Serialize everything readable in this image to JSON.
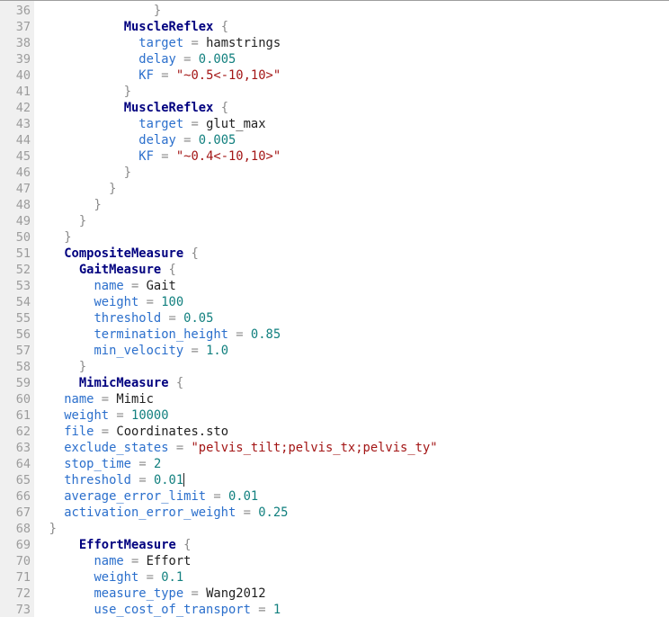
{
  "editor": {
    "name": "code-editor",
    "language": "scone-config",
    "first_visible_line": 36,
    "last_visible_line": 73,
    "cursor": {
      "line": 65,
      "column": 21,
      "after_text": "threshold = 0.01"
    },
    "colors": {
      "background": "#ffffff",
      "gutter_background": "#f0f0f0",
      "gutter_text": "#9c9c9c",
      "type_name": "#00007f",
      "property": "#2b6fcc",
      "number": "#12807f",
      "string": "#a31515",
      "punctuation": "#8a8a8a",
      "plain_text": "#1f1f1f",
      "caret": "#202020",
      "top_border": "#9e9e9e"
    }
  },
  "lines": [
    {
      "num": "36",
      "indent": 14,
      "tokens": [
        {
          "t": "}",
          "c": "punc"
        }
      ]
    },
    {
      "num": "37",
      "indent": 10,
      "tokens": [
        {
          "t": "MuscleReflex",
          "c": "type"
        },
        {
          "t": " ",
          "c": "plain"
        },
        {
          "t": "{",
          "c": "punc"
        }
      ]
    },
    {
      "num": "38",
      "indent": 12,
      "tokens": [
        {
          "t": "target",
          "c": "prop"
        },
        {
          "t": " ",
          "c": "plain"
        },
        {
          "t": "=",
          "c": "punc"
        },
        {
          "t": " ",
          "c": "plain"
        },
        {
          "t": "hamstrings",
          "c": "plain"
        }
      ]
    },
    {
      "num": "39",
      "indent": 12,
      "tokens": [
        {
          "t": "delay",
          "c": "prop"
        },
        {
          "t": " ",
          "c": "plain"
        },
        {
          "t": "=",
          "c": "punc"
        },
        {
          "t": " ",
          "c": "plain"
        },
        {
          "t": "0.005",
          "c": "num"
        }
      ]
    },
    {
      "num": "40",
      "indent": 12,
      "tokens": [
        {
          "t": "KF",
          "c": "prop"
        },
        {
          "t": " ",
          "c": "plain"
        },
        {
          "t": "=",
          "c": "punc"
        },
        {
          "t": " ",
          "c": "plain"
        },
        {
          "t": "\"~0.5<-10,10>\"",
          "c": "str"
        }
      ]
    },
    {
      "num": "41",
      "indent": 10,
      "tokens": [
        {
          "t": "}",
          "c": "punc"
        }
      ]
    },
    {
      "num": "42",
      "indent": 10,
      "tokens": [
        {
          "t": "MuscleReflex",
          "c": "type"
        },
        {
          "t": " ",
          "c": "plain"
        },
        {
          "t": "{",
          "c": "punc"
        }
      ]
    },
    {
      "num": "43",
      "indent": 12,
      "tokens": [
        {
          "t": "target",
          "c": "prop"
        },
        {
          "t": " ",
          "c": "plain"
        },
        {
          "t": "=",
          "c": "punc"
        },
        {
          "t": " ",
          "c": "plain"
        },
        {
          "t": "glut_max",
          "c": "plain"
        }
      ]
    },
    {
      "num": "44",
      "indent": 12,
      "tokens": [
        {
          "t": "delay",
          "c": "prop"
        },
        {
          "t": " ",
          "c": "plain"
        },
        {
          "t": "=",
          "c": "punc"
        },
        {
          "t": " ",
          "c": "plain"
        },
        {
          "t": "0.005",
          "c": "num"
        }
      ]
    },
    {
      "num": "45",
      "indent": 12,
      "tokens": [
        {
          "t": "KF",
          "c": "prop"
        },
        {
          "t": " ",
          "c": "plain"
        },
        {
          "t": "=",
          "c": "punc"
        },
        {
          "t": " ",
          "c": "plain"
        },
        {
          "t": "\"~0.4<-10,10>\"",
          "c": "str"
        }
      ]
    },
    {
      "num": "46",
      "indent": 10,
      "tokens": [
        {
          "t": "}",
          "c": "punc"
        }
      ]
    },
    {
      "num": "47",
      "indent": 8,
      "tokens": [
        {
          "t": "}",
          "c": "punc"
        }
      ]
    },
    {
      "num": "48",
      "indent": 6,
      "tokens": [
        {
          "t": "}",
          "c": "punc"
        }
      ]
    },
    {
      "num": "49",
      "indent": 4,
      "tokens": [
        {
          "t": "}",
          "c": "punc"
        }
      ]
    },
    {
      "num": "50",
      "indent": 2,
      "tokens": [
        {
          "t": "}",
          "c": "punc"
        }
      ]
    },
    {
      "num": "51",
      "indent": 2,
      "tokens": [
        {
          "t": "CompositeMeasure",
          "c": "type"
        },
        {
          "t": " ",
          "c": "plain"
        },
        {
          "t": "{",
          "c": "punc"
        }
      ]
    },
    {
      "num": "52",
      "indent": 4,
      "tokens": [
        {
          "t": "GaitMeasure",
          "c": "type"
        },
        {
          "t": " ",
          "c": "plain"
        },
        {
          "t": "{",
          "c": "punc"
        }
      ]
    },
    {
      "num": "53",
      "indent": 6,
      "tokens": [
        {
          "t": "name",
          "c": "prop"
        },
        {
          "t": " ",
          "c": "plain"
        },
        {
          "t": "=",
          "c": "punc"
        },
        {
          "t": " ",
          "c": "plain"
        },
        {
          "t": "Gait",
          "c": "plain"
        }
      ]
    },
    {
      "num": "54",
      "indent": 6,
      "tokens": [
        {
          "t": "weight",
          "c": "prop"
        },
        {
          "t": " ",
          "c": "plain"
        },
        {
          "t": "=",
          "c": "punc"
        },
        {
          "t": " ",
          "c": "plain"
        },
        {
          "t": "100",
          "c": "num"
        }
      ]
    },
    {
      "num": "55",
      "indent": 6,
      "tokens": [
        {
          "t": "threshold",
          "c": "prop"
        },
        {
          "t": " ",
          "c": "plain"
        },
        {
          "t": "=",
          "c": "punc"
        },
        {
          "t": " ",
          "c": "plain"
        },
        {
          "t": "0.05",
          "c": "num"
        }
      ]
    },
    {
      "num": "56",
      "indent": 6,
      "tokens": [
        {
          "t": "termination_height",
          "c": "prop"
        },
        {
          "t": " ",
          "c": "plain"
        },
        {
          "t": "=",
          "c": "punc"
        },
        {
          "t": " ",
          "c": "plain"
        },
        {
          "t": "0.85",
          "c": "num"
        }
      ]
    },
    {
      "num": "57",
      "indent": 6,
      "tokens": [
        {
          "t": "min_velocity",
          "c": "prop"
        },
        {
          "t": " ",
          "c": "plain"
        },
        {
          "t": "=",
          "c": "punc"
        },
        {
          "t": " ",
          "c": "plain"
        },
        {
          "t": "1.0",
          "c": "num"
        }
      ]
    },
    {
      "num": "58",
      "indent": 4,
      "tokens": [
        {
          "t": "}",
          "c": "punc"
        }
      ]
    },
    {
      "num": "59",
      "indent": 4,
      "tokens": [
        {
          "t": "MimicMeasure",
          "c": "type"
        },
        {
          "t": " ",
          "c": "plain"
        },
        {
          "t": "{",
          "c": "punc"
        }
      ]
    },
    {
      "num": "60",
      "indent": 2,
      "tokens": [
        {
          "t": "name",
          "c": "prop"
        },
        {
          "t": " ",
          "c": "plain"
        },
        {
          "t": "=",
          "c": "punc"
        },
        {
          "t": " ",
          "c": "plain"
        },
        {
          "t": "Mimic",
          "c": "plain"
        }
      ]
    },
    {
      "num": "61",
      "indent": 2,
      "tokens": [
        {
          "t": "weight",
          "c": "prop"
        },
        {
          "t": " ",
          "c": "plain"
        },
        {
          "t": "=",
          "c": "punc"
        },
        {
          "t": " ",
          "c": "plain"
        },
        {
          "t": "10000",
          "c": "num"
        }
      ]
    },
    {
      "num": "62",
      "indent": 2,
      "tokens": [
        {
          "t": "file",
          "c": "prop"
        },
        {
          "t": " ",
          "c": "plain"
        },
        {
          "t": "=",
          "c": "punc"
        },
        {
          "t": " ",
          "c": "plain"
        },
        {
          "t": "Coordinates.sto",
          "c": "plain"
        }
      ]
    },
    {
      "num": "63",
      "indent": 2,
      "tokens": [
        {
          "t": "exclude_states",
          "c": "prop"
        },
        {
          "t": " ",
          "c": "plain"
        },
        {
          "t": "=",
          "c": "punc"
        },
        {
          "t": " ",
          "c": "plain"
        },
        {
          "t": "\"pelvis_tilt;pelvis_tx;pelvis_ty\"",
          "c": "str"
        }
      ]
    },
    {
      "num": "64",
      "indent": 2,
      "tokens": [
        {
          "t": "stop_time",
          "c": "prop"
        },
        {
          "t": " ",
          "c": "plain"
        },
        {
          "t": "=",
          "c": "punc"
        },
        {
          "t": " ",
          "c": "plain"
        },
        {
          "t": "2",
          "c": "num"
        }
      ]
    },
    {
      "num": "65",
      "indent": 2,
      "caret_at_end": true,
      "tokens": [
        {
          "t": "threshold",
          "c": "prop"
        },
        {
          "t": " ",
          "c": "plain"
        },
        {
          "t": "=",
          "c": "punc"
        },
        {
          "t": " ",
          "c": "plain"
        },
        {
          "t": "0.01",
          "c": "num"
        }
      ]
    },
    {
      "num": "66",
      "indent": 2,
      "tokens": [
        {
          "t": "average_error_limit",
          "c": "prop"
        },
        {
          "t": " ",
          "c": "plain"
        },
        {
          "t": "=",
          "c": "punc"
        },
        {
          "t": " ",
          "c": "plain"
        },
        {
          "t": "0.01",
          "c": "num"
        }
      ]
    },
    {
      "num": "67",
      "indent": 2,
      "tokens": [
        {
          "t": "activation_error_weight",
          "c": "prop"
        },
        {
          "t": " ",
          "c": "plain"
        },
        {
          "t": "=",
          "c": "punc"
        },
        {
          "t": " ",
          "c": "plain"
        },
        {
          "t": "0.25",
          "c": "num"
        }
      ]
    },
    {
      "num": "68",
      "indent": 0,
      "tokens": [
        {
          "t": "}",
          "c": "punc"
        }
      ]
    },
    {
      "num": "69",
      "indent": 4,
      "tokens": [
        {
          "t": "EffortMeasure",
          "c": "type"
        },
        {
          "t": " ",
          "c": "plain"
        },
        {
          "t": "{",
          "c": "punc"
        }
      ]
    },
    {
      "num": "70",
      "indent": 6,
      "tokens": [
        {
          "t": "name",
          "c": "prop"
        },
        {
          "t": " ",
          "c": "plain"
        },
        {
          "t": "=",
          "c": "punc"
        },
        {
          "t": " ",
          "c": "plain"
        },
        {
          "t": "Effort",
          "c": "plain"
        }
      ]
    },
    {
      "num": "71",
      "indent": 6,
      "tokens": [
        {
          "t": "weight",
          "c": "prop"
        },
        {
          "t": " ",
          "c": "plain"
        },
        {
          "t": "=",
          "c": "punc"
        },
        {
          "t": " ",
          "c": "plain"
        },
        {
          "t": "0.1",
          "c": "num"
        }
      ]
    },
    {
      "num": "72",
      "indent": 6,
      "tokens": [
        {
          "t": "measure_type",
          "c": "prop"
        },
        {
          "t": " ",
          "c": "plain"
        },
        {
          "t": "=",
          "c": "punc"
        },
        {
          "t": " ",
          "c": "plain"
        },
        {
          "t": "Wang2012",
          "c": "plain"
        }
      ]
    },
    {
      "num": "73",
      "indent": 6,
      "tokens": [
        {
          "t": "use_cost_of_transport",
          "c": "prop"
        },
        {
          "t": " ",
          "c": "plain"
        },
        {
          "t": "=",
          "c": "punc"
        },
        {
          "t": " ",
          "c": "plain"
        },
        {
          "t": "1",
          "c": "num"
        }
      ]
    }
  ]
}
